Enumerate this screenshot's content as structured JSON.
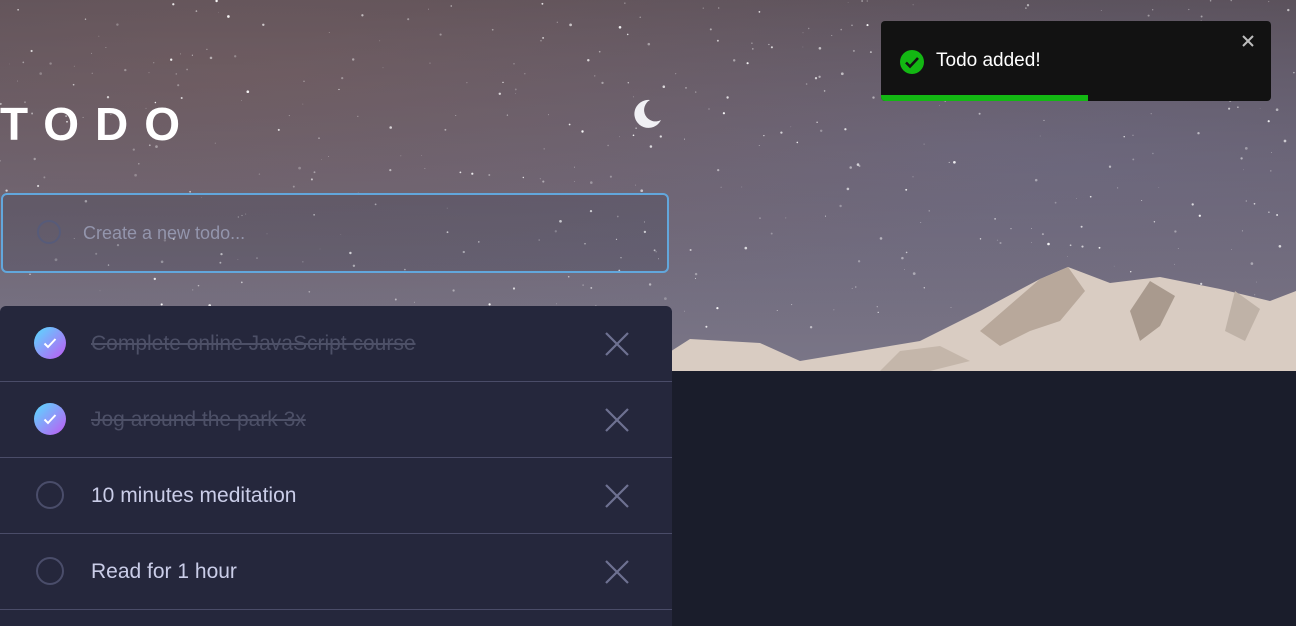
{
  "app": {
    "title": "TODO"
  },
  "theme_toggle": {
    "icon": "moon-icon"
  },
  "new_todo": {
    "placeholder": "Create a new todo..."
  },
  "todos": [
    {
      "text": "Complete online JavaScript course",
      "completed": true
    },
    {
      "text": "Jog around the park 3x",
      "completed": true
    },
    {
      "text": "10 minutes meditation",
      "completed": false
    },
    {
      "text": "Read for 1 hour",
      "completed": false
    }
  ],
  "toast": {
    "message": "Todo added!",
    "icon": "success-check-icon",
    "progress_fraction": 0.53
  },
  "colors": {
    "accent_border": "#62a7dc",
    "check_gradient_start": "#57ddff",
    "check_gradient_end": "#c058f3",
    "list_background": "#25273c",
    "page_background": "#1a1d2b",
    "toast_background": "#121212",
    "toast_success": "#13b713"
  }
}
